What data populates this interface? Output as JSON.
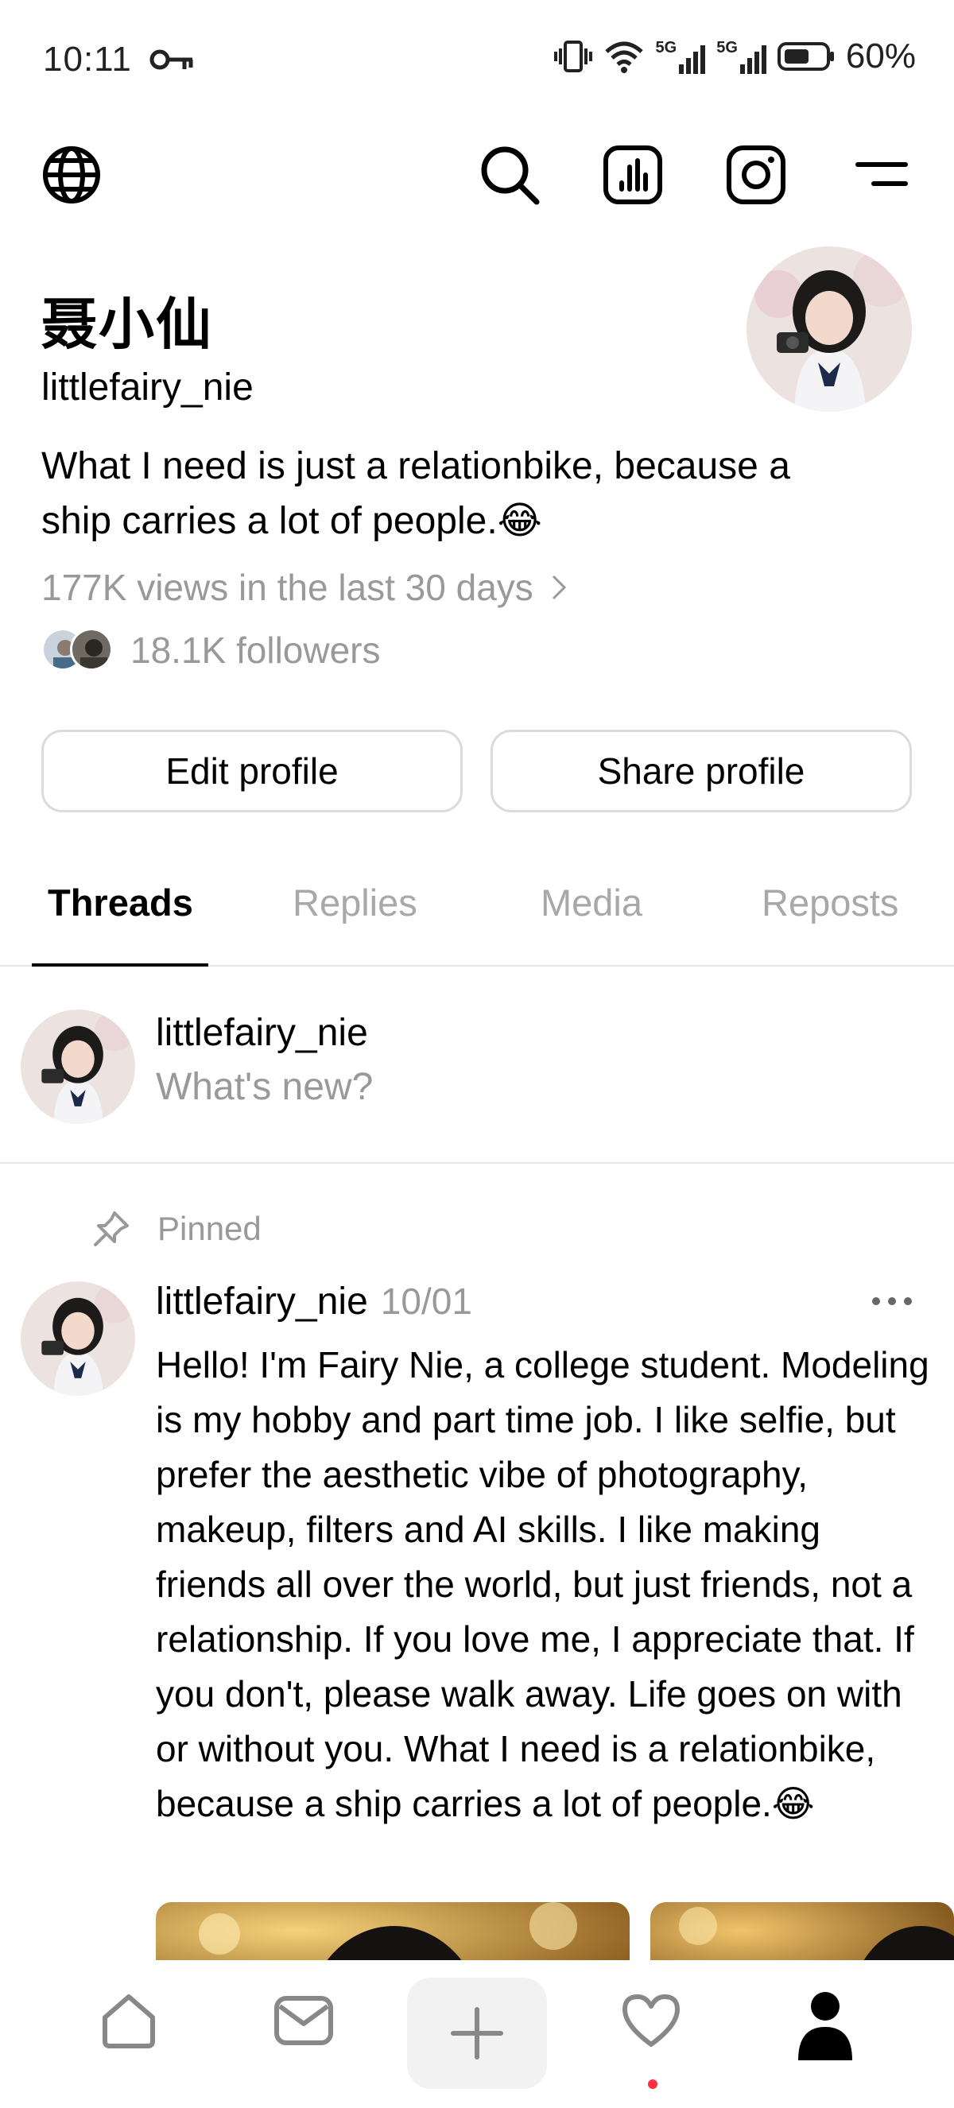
{
  "status_bar": {
    "time": "10:11",
    "battery": "60%",
    "net1": "5G",
    "net2": "5G"
  },
  "profile": {
    "display_name": "聂小仙",
    "username": "littlefairy_nie",
    "bio": "What I need is just a relationbike, because a ship carries a lot of people.😂",
    "views": "177K views in the last 30 days",
    "followers": "18.1K followers"
  },
  "buttons": {
    "edit_label": "Edit profile",
    "share_label": "Share profile"
  },
  "tabs": [
    {
      "label": "Threads",
      "active": true
    },
    {
      "label": "Replies",
      "active": false
    },
    {
      "label": "Media",
      "active": false
    },
    {
      "label": "Reposts",
      "active": false
    }
  ],
  "composer": {
    "username": "littlefairy_nie",
    "placeholder": "What's new?"
  },
  "post": {
    "pinned_label": "Pinned",
    "username": "littlefairy_nie",
    "date": "10/01",
    "text": "Hello! I'm Fairy Nie, a college student. Modeling is my hobby and part time job. I like selfie, but prefer the aesthetic vibe of photography, makeup, filters and AI skills. I like making friends all over the world, but just friends, not a relationship. If you love me, I appreciate that. If you don't, please walk away. Life goes on with or without you. What I need is a relationbike, because a ship carries a lot of people.😂"
  },
  "icons": {
    "top_bar": [
      "globe-icon",
      "search-icon",
      "insights-icon",
      "instagram-icon",
      "menu-icon"
    ],
    "bottom_nav": [
      "home-icon",
      "inbox-icon",
      "create-icon",
      "heart-icon",
      "profile-icon"
    ]
  },
  "colors": {
    "muted_text": "#999999",
    "border": "#dbdbdb",
    "notification_dot": "#ff3040"
  }
}
